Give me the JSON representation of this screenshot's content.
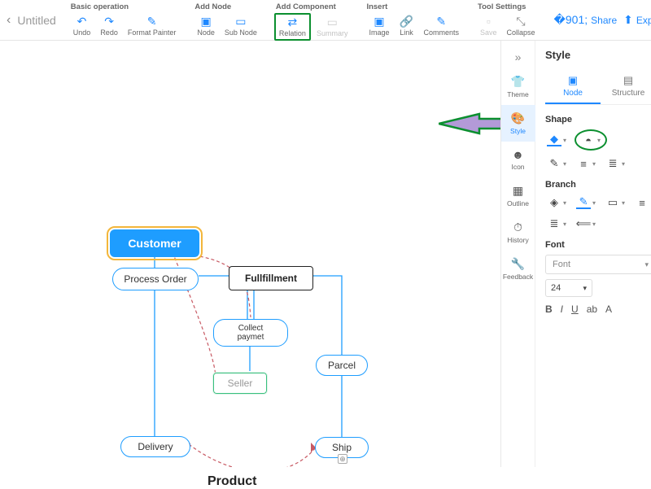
{
  "title": "Untitled",
  "toolbar": {
    "groups": {
      "basic": {
        "label": "Basic operation",
        "undo": "Undo",
        "redo": "Redo",
        "format": "Format Painter"
      },
      "addnode": {
        "label": "Add Node",
        "node": "Node",
        "subnode": "Sub Node"
      },
      "addcomp": {
        "label": "Add Component",
        "relation": "Relation",
        "summary": "Summary"
      },
      "insert": {
        "label": "Insert",
        "image": "Image",
        "link": "Link",
        "comments": "Comments"
      },
      "tools": {
        "label": "Tool Settings",
        "save": "Save",
        "collapse": "Collapse"
      }
    }
  },
  "actions": {
    "share": "Share",
    "export": "Export"
  },
  "nodes": {
    "customer": "Customer",
    "process": "Process Order",
    "fulfill": "Fullfillment",
    "collect": "Collect paymet",
    "seller": "Seller",
    "parcel": "Parcel",
    "delivery": "Delivery",
    "ship": "Ship",
    "product": "Product"
  },
  "side": {
    "title": "Style",
    "tabs": {
      "theme": "Theme",
      "style": "Style",
      "icon": "Icon",
      "outline": "Outline",
      "history": "History",
      "feedback": "Feedback"
    },
    "inner_tabs": {
      "node": "Node",
      "structure": "Structure"
    },
    "sections": {
      "shape": "Shape",
      "branch": "Branch",
      "font": "Font"
    },
    "font": {
      "placeholder": "Font",
      "size": "24"
    },
    "fmt": {
      "b": "B",
      "i": "I",
      "u": "U",
      "ab": "ab",
      "a": "A"
    }
  }
}
